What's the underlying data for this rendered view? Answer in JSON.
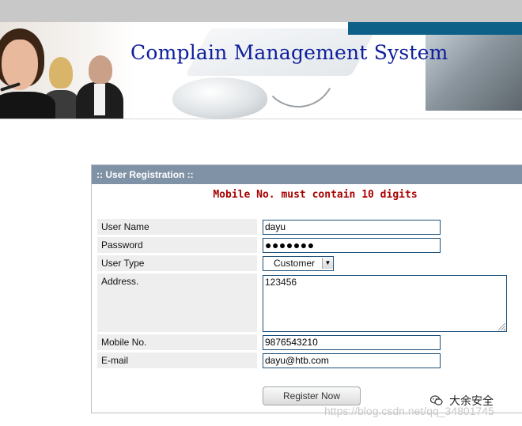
{
  "header": {
    "title": "Complain Management System"
  },
  "panel": {
    "title": ":: User Registration ::",
    "error_message": "Mobile No. must contain 10 digits"
  },
  "form": {
    "username": {
      "label": "User Name",
      "value": "dayu"
    },
    "password": {
      "label": "Password",
      "value": "●●●●●●●"
    },
    "user_type": {
      "label": "User Type",
      "selected": "Customer",
      "arrow": "▼"
    },
    "address": {
      "label": "Address.",
      "value": "123456"
    },
    "mobile": {
      "label": "Mobile No.",
      "value": "9876543210"
    },
    "email": {
      "label": "E-mail",
      "value": "dayu@htb.com"
    },
    "submit_label": "Register Now"
  },
  "overlay": {
    "watermark": "https://blog.csdn.net/qq_34801745",
    "wechat_label": "大余安全",
    "wechat_icon": "wechat-icon"
  }
}
